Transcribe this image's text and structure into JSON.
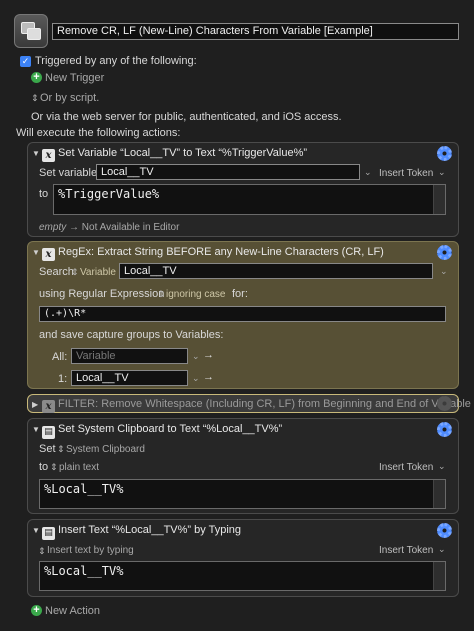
{
  "macro": {
    "name": "Remove CR, LF (New-Line) Characters From Variable [Example]",
    "triggered_label": "Triggered by any of the following:",
    "new_trigger": "New Trigger",
    "or_by_script": "Or by script.",
    "web_server": "Or via the web server for public, authenticated, and iOS access.",
    "will_execute": "Will execute the following actions:",
    "new_action": "New Action"
  },
  "actions": [
    {
      "title": "Set Variable “Local__TV” to Text “%TriggerValue%”",
      "set_variable_label": "Set variable",
      "variable_value": "Local__TV",
      "insert_token": "Insert Token",
      "to_label": "to",
      "text_value": "%TriggerValue%",
      "hint_empty": "empty",
      "hint_text": "Not Available in Editor"
    },
    {
      "title": "RegEx:  Extract String BEFORE any New-Line Characters (CR, LF)",
      "search_label": "Search",
      "search_type": "Variable",
      "search_value": "Local__TV",
      "using_label": "using Regular Expression",
      "ignoring_case": "ignoring case",
      "for_label": "for:",
      "regex_value": "(.+)\\R*",
      "capture_label": "and save capture groups to Variables:",
      "all_label": "All:",
      "all_placeholder": "Variable",
      "group1_label": "1:",
      "group1_value": "Local__TV"
    },
    {
      "title": "FILTER:  Remove Whitespace (Including CR, LF) from Beginning and End of Variable"
    },
    {
      "title": "Set System Clipboard to Text “%Local__TV%”",
      "set_label": "Set",
      "clipboard_type": "System Clipboard",
      "to_label": "to",
      "plain_text": "plain text",
      "insert_token": "Insert Token",
      "text_value": "%Local__TV%"
    },
    {
      "title": "Insert Text “%Local__TV%” by Typing",
      "mode": "Insert text by typing",
      "insert_token": "Insert Token",
      "text_value": "%Local__TV%"
    }
  ],
  "colors": {
    "background": "#1f1f1f",
    "regex_action": "#575035",
    "accent_blue": "#3c82f6",
    "add_green": "#3aa84b"
  }
}
